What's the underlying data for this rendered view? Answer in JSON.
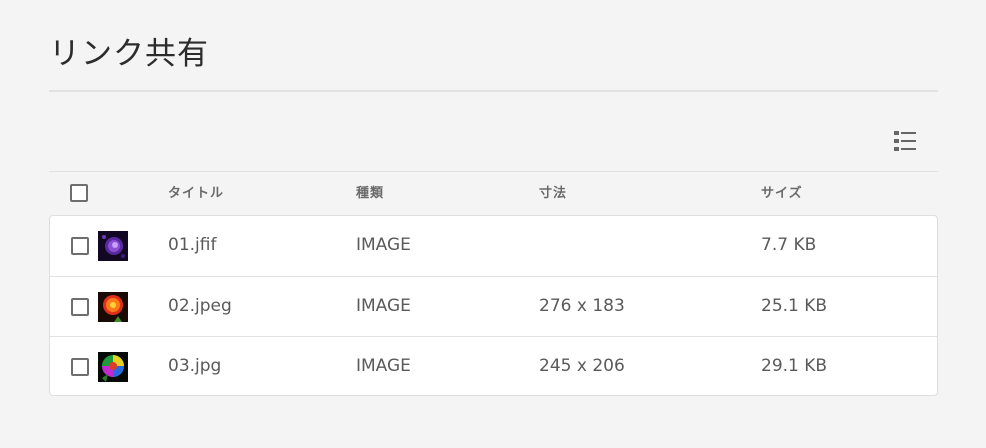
{
  "page": {
    "title": "リンク共有"
  },
  "toolbar": {
    "view_toggle_icon": "list-view-icon"
  },
  "table": {
    "columns": [
      "タイトル",
      "種類",
      "寸法",
      "サイズ"
    ],
    "rows": [
      {
        "title": "01.jfif",
        "type": "IMAGE",
        "dimensions": "",
        "size": "7.7 KB",
        "thumbnail": "purple-flower-thumbnail"
      },
      {
        "title": "02.jpeg",
        "type": "IMAGE",
        "dimensions": "276 x 183",
        "size": "25.1 KB",
        "thumbnail": "orange-flower-thumbnail"
      },
      {
        "title": "03.jpg",
        "type": "IMAGE",
        "dimensions": "245 x 206",
        "size": "29.1 KB",
        "thumbnail": "rainbow-rose-thumbnail"
      }
    ]
  }
}
